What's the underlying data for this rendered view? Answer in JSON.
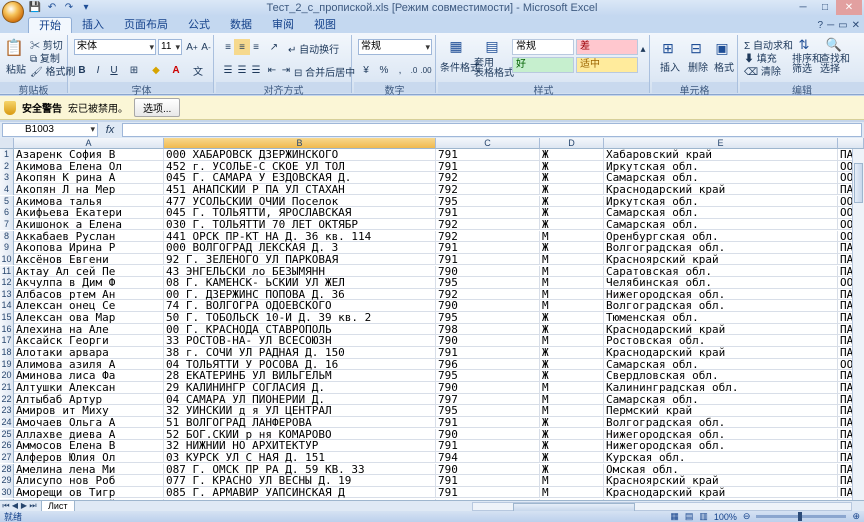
{
  "window": {
    "title": "Тест_2_с_пропиской.xls  [Режим совместимости] - Microsoft Excel",
    "minimize_icon": "minimize-icon",
    "maximize_icon": "maximize-icon",
    "close_icon": "close-icon"
  },
  "ribbon_tabs": [
    "开始",
    "插入",
    "页面布局",
    "公式",
    "数据",
    "审阅",
    "视图"
  ],
  "ribbon": {
    "clipboard": {
      "label": "剪贴板",
      "paste": "粘贴",
      "cut": "剪切",
      "copy": "复制",
      "format_painter": "格式刷"
    },
    "font": {
      "label": "字体",
      "name": "宋体",
      "size": "11",
      "bold": "B",
      "italic": "I",
      "underline": "U"
    },
    "alignment": {
      "label": "对齐方式",
      "wrap": "自动换行",
      "merge": "合并后居中"
    },
    "number": {
      "label": "数字",
      "format": "常规",
      "percent": "%",
      "comma": ","
    },
    "styles": {
      "label": "样式",
      "conditional": "条件格式",
      "table": "套用\n表格格式",
      "normal": "常规",
      "bad": "差",
      "good": "好",
      "neutral": "适中"
    },
    "cells": {
      "label": "单元格",
      "insert": "插入",
      "delete": "删除",
      "format": "格式"
    },
    "editing": {
      "label": "编辑",
      "autosum": "自动求和",
      "fill": "填充",
      "clear": "清除",
      "sort": "排序和\n筛选",
      "find": "查找和\n选择"
    }
  },
  "security": {
    "title": "安全警告",
    "message": "宏已被禁用。",
    "options_button": "选项..."
  },
  "formula_bar": {
    "name_box": "B1003",
    "fx": "fx",
    "content": ""
  },
  "columns": [
    "A",
    "B",
    "C",
    "D",
    "E"
  ],
  "rows": [
    {
      "n": "1",
      "a": "Азаренк  София В",
      "b": "000  ХАБАРОВСК    ДЗЕРЖИНСКОГО",
      "c": "791",
      "d": "Ж",
      "e": "Хабаровский край",
      "f": "ПА"
    },
    {
      "n": "2",
      "a": "Акимова  Елена Ол",
      "b": "452  г. УСОЛЬЕ-С     СКОЕ УЛ ТОЛ",
      "c": "791",
      "d": "Ж",
      "e": "Иркутская обл.",
      "f": "ОО"
    },
    {
      "n": "3",
      "a": "Акопян К  рина А",
      "b": "045  Г. САМАРА У    ЕЗДОВСКАЯ Д.",
      "c": "792",
      "d": "Ж",
      "e": "Самарская обл.",
      "f": "ОО"
    },
    {
      "n": "4",
      "a": "Акопян Л  на Мер",
      "b": "451  АНАПСКИЙ Р     ПА УЛ СТАХАН",
      "c": "792",
      "d": "Ж",
      "e": "Краснодарский край",
      "f": "ПА"
    },
    {
      "n": "5",
      "a": "Акимова  талья",
      "b": "477  УСОЛЬСКИЙ      ОЧИЙ Поселок",
      "c": "795",
      "d": "Ж",
      "e": "Иркутская обл.",
      "f": "ОО"
    },
    {
      "n": "6",
      "a": "Акифьева Екатери",
      "b": "045  Г. ТОЛЬЯТТИ,  ЯРОСЛАВСКАЯ",
      "c": "791",
      "d": "Ж",
      "e": "Самарская обл.",
      "f": "ОО"
    },
    {
      "n": "7",
      "a": "Акишонок  а Елена",
      "b": "030  Г. ТОЛЬЯТТИ    70 ЛЕТ ОКТЯБР",
      "c": "792",
      "d": "Ж",
      "e": "Самарская обл.",
      "f": "ОО"
    },
    {
      "n": "8",
      "a": "Аккабаев  Руслан",
      "b": "441  ОРСК ПР-КТ      НА Д. 36 кв. 114",
      "c": "792",
      "d": "М",
      "e": "Оренбургская обл.",
      "f": "ОО"
    },
    {
      "n": "9",
      "a": "Акопова  Ирина Р",
      "b": "000  ВОЛГОГРАД    ЛЕКСКАЯ Д. 3",
      "c": "791",
      "d": "Ж",
      "e": "Волгоградская обл.",
      "f": "ПА"
    },
    {
      "n": "10",
      "a": "Аксёнов  Евгени",
      "b": "92  Г. ЗЕЛЕНОГО    УЛ ПАРКОВАЯ",
      "c": "791",
      "d": "М",
      "e": "Красноярский край",
      "f": "ПА"
    },
    {
      "n": "11",
      "a": "Актау Ал  сей Пе",
      "b": "43  ЭНГЕЛЬСКИ     ло БЕЗЫМЯНН",
      "c": "790",
      "d": "М",
      "e": "Саратовская обл.",
      "f": "ПА"
    },
    {
      "n": "12",
      "a": "Акчулпа  в Дим Ф",
      "b": "08  Г. КАМЕНСК-    ЬСКИЙ УЛ ЖЕЛ",
      "c": "795",
      "d": "М",
      "e": "Челябинская обл.",
      "f": "ОО"
    },
    {
      "n": "13",
      "a": "Албасов  ртем Ан",
      "b": "00  Г. ДЗЕРЖИНС     ПОПОВА Д. 36",
      "c": "792",
      "d": "М",
      "e": "Нижегородская обл.",
      "f": "ПА"
    },
    {
      "n": "14",
      "a": "Алексан  онец Се",
      "b": "74  Г. ВОЛГОГРА    ОДОЕВСКОГО",
      "c": "790",
      "d": "М",
      "e": "Волгоградская обл.",
      "f": "ПА"
    },
    {
      "n": "15",
      "a": "Алексан  ова Мар",
      "b": "50  Г. ТОБОЛЬСК    10-Й Д. 39 кв. 2",
      "c": "795",
      "d": "Ж",
      "e": "Тюменская обл.",
      "f": "ПА"
    },
    {
      "n": "16",
      "a": "Алехина   на Але",
      "b": "00  Г. КРАСНОДА   СТАВРОПОЛЬ",
      "c": "798",
      "d": "Ж",
      "e": "Краснодарский край",
      "f": "ПА"
    },
    {
      "n": "17",
      "a": "Аксайск  Георги",
      "b": "33  РОСТОВ-НА-    УЛ ВСЕСОЮЗН",
      "c": "790",
      "d": "М",
      "e": "Ростовская обл.",
      "f": "ПА"
    },
    {
      "n": "18",
      "a": "Алотаки  арвара",
      "b": "38  г. СОЧИ УЛ   РАДНАЯ Д. 150",
      "c": "791",
      "d": "Ж",
      "e": "Краснодарский край",
      "f": "ПА"
    },
    {
      "n": "19",
      "a": "Алимова  азиля А",
      "b": "04  ТОЛЬЯТТИ У    РОСОВА Д. 16",
      "c": "796",
      "d": "Ж",
      "e": "Самарская обл.",
      "f": "ОО"
    },
    {
      "n": "20",
      "a": "Аминова  лиса Фа",
      "b": "28  ЕКАТЕРИНБ    УЛ ВИЛЬГЕЛЬМ",
      "c": "795",
      "d": "Ж",
      "e": "Свердловская обл.",
      "f": "ПА"
    },
    {
      "n": "21",
      "a": "Алтушки  Алексан",
      "b": "29  КАЛИНИНГР    СОГЛАСИЯ Д.",
      "c": "790",
      "d": "М",
      "e": "Калининградская обл.",
      "f": "ПА"
    },
    {
      "n": "22",
      "a": "Алтыбаб  Артур",
      "b": "04  САМАРА УЛ    ПИОНЕРИИ Д.",
      "c": "797",
      "d": "М",
      "e": "Самарская обл.",
      "f": "ПА"
    },
    {
      "n": "23",
      "a": "Амиров   ит Миху",
      "b": "32  УИНСКИЙ д    я УЛ ЦЕНТРАЛ",
      "c": "795",
      "d": "М",
      "e": "Пермский край",
      "f": "ПА"
    },
    {
      "n": "24",
      "a": "Амочаев  Ольга А",
      "b": "51  ВОЛГОГРАД    ЛАНФЕРОВА",
      "c": "791",
      "d": "Ж",
      "e": "Волгоградская обл.",
      "f": "ПА"
    },
    {
      "n": "25",
      "a": "Аллахве  диева А",
      "b": "52  БОГ.СКИЙ р   ня КОМАРОВО",
      "c": "790",
      "d": "Ж",
      "e": "Нижегородская обл.",
      "f": "ПА"
    },
    {
      "n": "26",
      "a": "Аммосов  Елена В",
      "b": "32  НИЖНИЙ НО     АРХИТЕКТУР",
      "c": "791",
      "d": "Ж",
      "e": "Нижегородская обл.",
      "f": "ПА"
    },
    {
      "n": "27",
      "a": "Алферов  Юлия Ол",
      "b": "03  КУРСК УЛ С   НАЯ Д. 151",
      "c": "794",
      "d": "Ж",
      "e": "Курская обл.",
      "f": "ПА"
    },
    {
      "n": "28",
      "a": "Амелина  лена Ми",
      "b": "087  Г. ОМСК ПР    РА Д. 59 КВ. 33",
      "c": "790",
      "d": "Ж",
      "e": "Омская обл.",
      "f": "ПА"
    },
    {
      "n": "29",
      "a": "Алисупо  нов Роб",
      "b": "077  Г. КРАСНО    УЛ ВЕСНЫ Д. 19",
      "c": "791",
      "d": "М",
      "e": "Красноярский край",
      "f": "ПА"
    },
    {
      "n": "30",
      "a": "Аморещи  ов Тигр",
      "b": "085  Г. АРМАВИР   УАПСИНСКАЯ Д",
      "c": "791",
      "d": "М",
      "e": "Краснодарский край",
      "f": "ПА"
    },
    {
      "n": "31",
      "a": "Андреев  Дмитрий",
      "b": "851  Г. ИРБИТ У    СИМА ГОРЬКОГ",
      "c": "792",
      "d": "М",
      "e": "Свердловская обл.",
      "f": "ПА"
    }
  ],
  "sheet_tab": "Лист",
  "status": {
    "ready": "就绪",
    "zoom": "100%"
  }
}
